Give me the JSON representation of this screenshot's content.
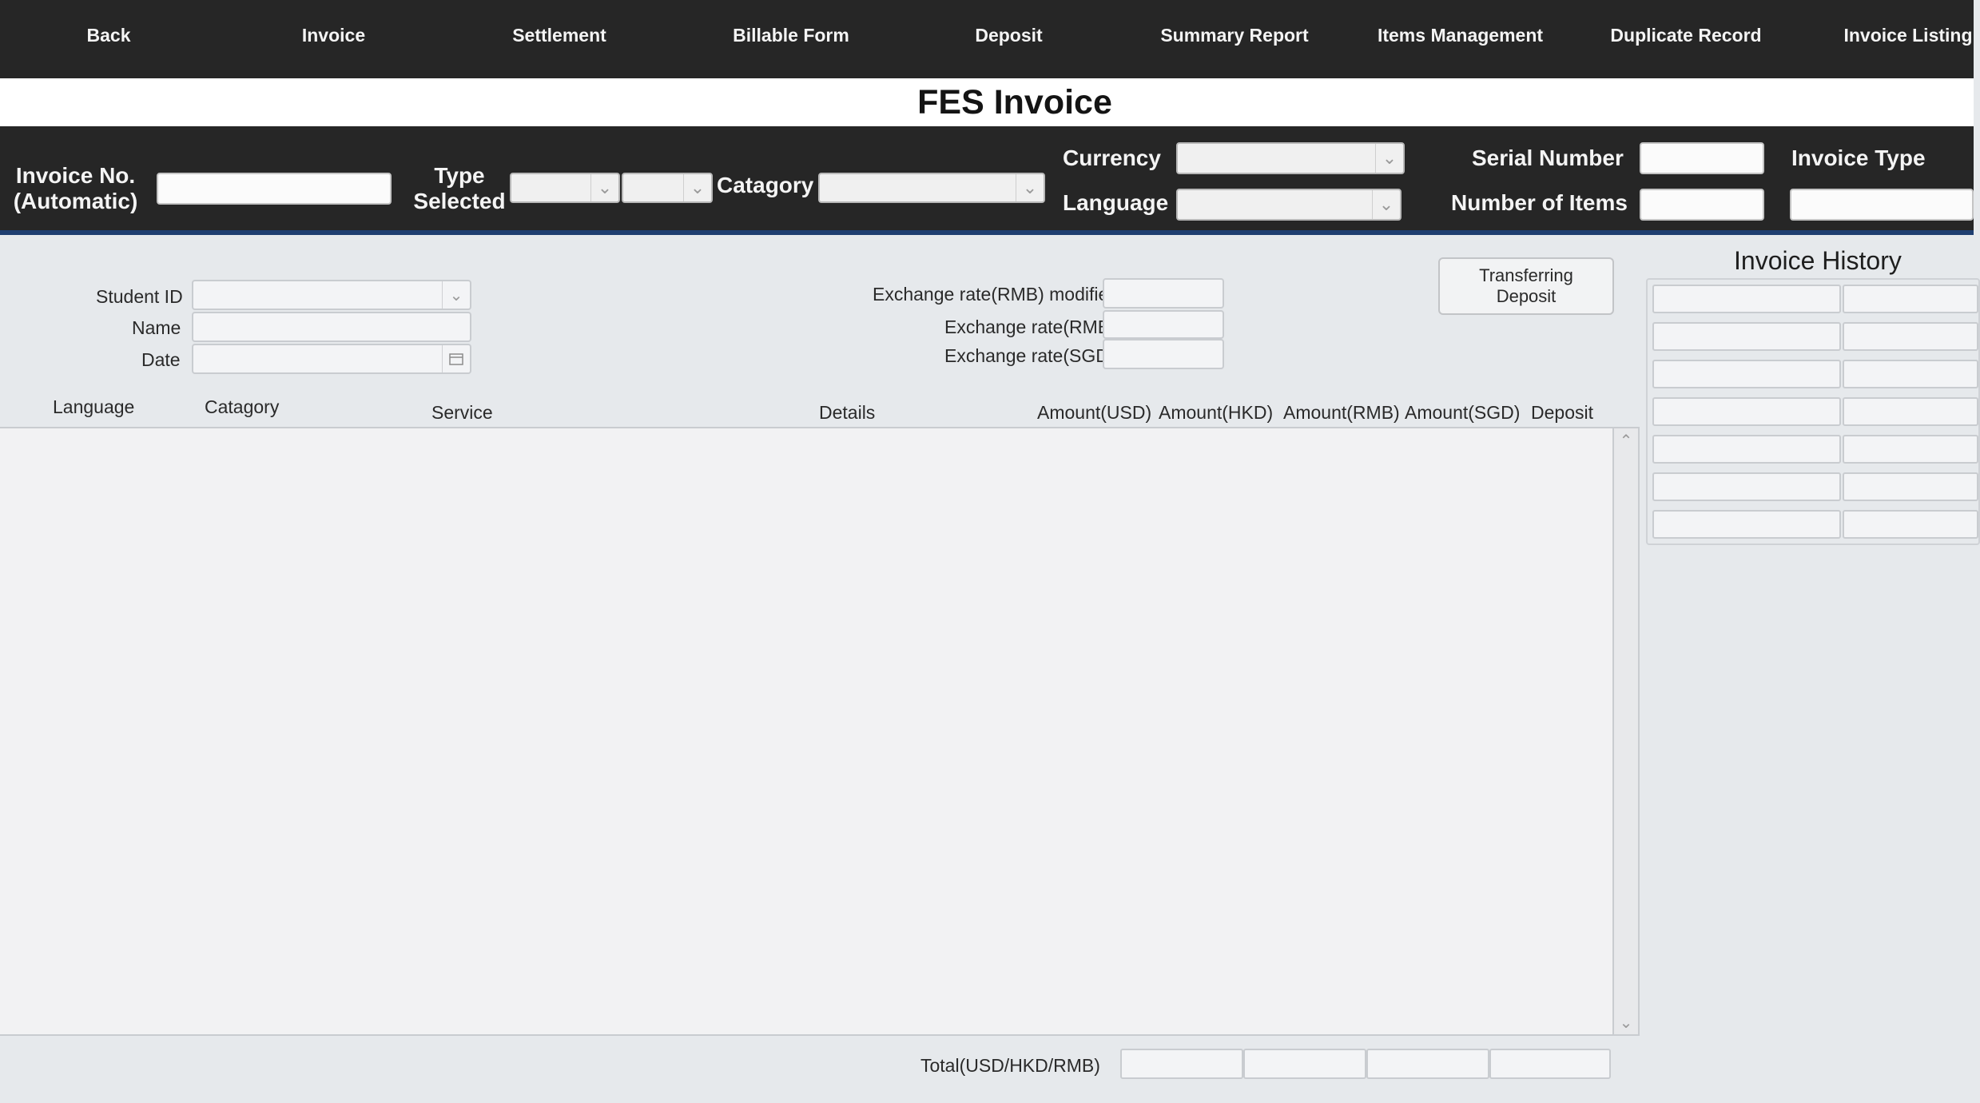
{
  "nav": {
    "items": [
      {
        "label": "Back"
      },
      {
        "label": "Invoice"
      },
      {
        "label": "Settlement"
      },
      {
        "label": "Billable Form"
      },
      {
        "label": "Deposit"
      },
      {
        "label": "Summary Report"
      },
      {
        "label": "Items Management"
      },
      {
        "label": "Duplicate Record"
      },
      {
        "label": "Invoice Listing"
      }
    ]
  },
  "page": {
    "title": "FES Invoice"
  },
  "header": {
    "invoice_no_label_1": "Invoice No.",
    "invoice_no_label_2": "(Automatic)",
    "invoice_no_value": "",
    "type_selected_label_1": "Type",
    "type_selected_label_2": "Selected",
    "type_select_1": "",
    "type_select_2": "",
    "catagory_label": "Catagory",
    "catagory_value": "",
    "currency_label": "Currency",
    "currency_value": "",
    "language_label": "Language",
    "language_value": "",
    "serial_number_label": "Serial Number",
    "serial_number_value": "",
    "number_of_items_label": "Number of Items",
    "number_of_items_value": "",
    "invoice_type_label": "Invoice Type",
    "invoice_type_value": ""
  },
  "form": {
    "student_id_label": "Student ID",
    "student_id_value": "",
    "name_label": "Name",
    "name_value": "",
    "date_label": "Date",
    "date_value": "",
    "exchange_rmb_modified_label": "Exchange rate(RMB) modified",
    "exchange_rmb_modified_value": "",
    "exchange_rmb_label": "Exchange rate(RMB)",
    "exchange_rmb_value": "",
    "exchange_sgd_label": "Exchange rate(SGD)",
    "exchange_sgd_value": "",
    "transfer_button_label_1": "Transferring",
    "transfer_button_label_2": "Deposit"
  },
  "table": {
    "columns": [
      {
        "label": "Language"
      },
      {
        "label": "Catagory"
      },
      {
        "label": "Service"
      },
      {
        "label": "Details"
      },
      {
        "label": "Amount(USD)"
      },
      {
        "label": "Amount(HKD)"
      },
      {
        "label": "Amount(RMB)"
      },
      {
        "label": "Amount(SGD)"
      },
      {
        "label": "Deposit"
      }
    ],
    "rows": []
  },
  "history": {
    "title": "Invoice History",
    "rows": [
      [
        "",
        ""
      ],
      [
        "",
        ""
      ],
      [
        "",
        ""
      ],
      [
        "",
        ""
      ],
      [
        "",
        ""
      ],
      [
        "",
        ""
      ],
      [
        "",
        ""
      ]
    ]
  },
  "totals": {
    "label": "Total(USD/HKD/RMB)",
    "values": [
      "",
      "",
      "",
      ""
    ]
  },
  "icons": {
    "dropdown": "chevron-down-icon",
    "calendar": "calendar-icon",
    "scroll_up": "chevron-up-icon",
    "scroll_down": "chevron-down-icon"
  },
  "colors": {
    "nav_bg": "#262626",
    "header_bg": "#262626",
    "header_accent": "#1f3e70",
    "page_bg": "#e6e9ec",
    "list_bg": "#f2f2f3"
  }
}
